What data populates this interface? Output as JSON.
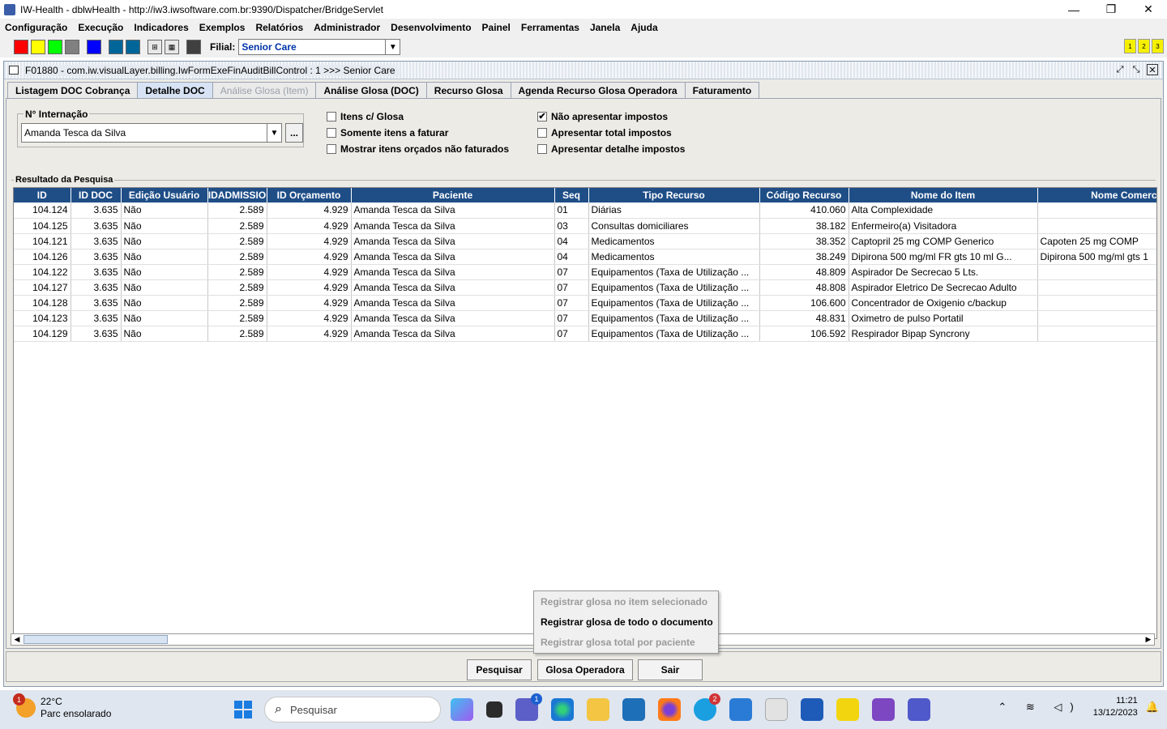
{
  "window": {
    "title": "IW-Health - dblwHealth - http://iw3.iwsoftware.com.br:9390/Dispatcher/BridgeServlet",
    "minimize": "—",
    "maximize": "❐",
    "close": "✕"
  },
  "menu": [
    "Configuração",
    "Execução",
    "Indicadores",
    "Exemplos",
    "Relatórios",
    "Administrador",
    "Desenvolvimento",
    "Painel",
    "Ferramentas",
    "Janela",
    "Ajuda"
  ],
  "toolbar": {
    "swatches": [
      "#ff0000",
      "#ffff00",
      "#00ff00",
      "#808080",
      "#0000ff",
      "#006699",
      "#006699"
    ],
    "filial_label": "Filial:",
    "filial_value": "Senior Care",
    "page_buttons": [
      "1",
      "2",
      "3"
    ]
  },
  "frame": {
    "title": "F01880 - com.iw.visualLayer.billing.IwFormExeFinAuditBillControl : 1 >>> Senior Care",
    "tabs": [
      {
        "label": "Listagem DOC Cobrança",
        "state": "normal"
      },
      {
        "label": "Detalhe DOC",
        "state": "active"
      },
      {
        "label": "Análise Glosa (Item)",
        "state": "disabled"
      },
      {
        "label": "Análise Glosa (DOC)",
        "state": "normal"
      },
      {
        "label": "Recurso Glosa",
        "state": "normal"
      },
      {
        "label": "Agenda Recurso Glosa Operadora",
        "state": "normal"
      },
      {
        "label": "Faturamento",
        "state": "normal"
      }
    ]
  },
  "filters": {
    "internacao_label": "N° Internação",
    "internacao_value": "Amanda Tesca da Silva",
    "lookup_button": "...",
    "checkboxes": [
      {
        "label": "Itens c/ Glosa",
        "checked": false
      },
      {
        "label": "Somente itens a faturar",
        "checked": false
      },
      {
        "label": "Mostrar itens orçados não faturados",
        "checked": false
      },
      {
        "label": "Não apresentar impostos",
        "checked": true
      },
      {
        "label": "Apresentar total impostos",
        "checked": false
      },
      {
        "label": "Apresentar detalhe impostos",
        "checked": false
      }
    ]
  },
  "results": {
    "label": "Resultado da Pesquisa",
    "columns": [
      "ID",
      "ID DOC",
      "Edição Usuário",
      "IDADMISSIO",
      "ID Orçamento",
      "Paciente",
      "Seq",
      "Tipo Recurso",
      "Código Recurso",
      "Nome do Item",
      "Nome Comerci"
    ],
    "rows": [
      [
        "104.124",
        "3.635",
        "Não",
        "2.589",
        "4.929",
        "Amanda Tesca da Silva",
        "01",
        "Diárias",
        "410.060",
        "Alta Complexidade",
        ""
      ],
      [
        "104.125",
        "3.635",
        "Não",
        "2.589",
        "4.929",
        "Amanda Tesca da Silva",
        "03",
        "Consultas domiciliares",
        "38.182",
        "Enfermeiro(a) Visitadora",
        ""
      ],
      [
        "104.121",
        "3.635",
        "Não",
        "2.589",
        "4.929",
        "Amanda Tesca da Silva",
        "04",
        "Medicamentos",
        "38.352",
        "Captopril    25 mg  COMP     Generico",
        "Capoten     25 mg  COMP"
      ],
      [
        "104.126",
        "3.635",
        "Não",
        "2.589",
        "4.929",
        "Amanda Tesca da Silva",
        "04",
        "Medicamentos",
        "38.249",
        "Dipirona    500 mg/ml  FR  gts 10 ml   G...",
        "Dipirona 500 mg/ml   gts 1"
      ],
      [
        "104.122",
        "3.635",
        "Não",
        "2.589",
        "4.929",
        "Amanda Tesca da Silva",
        "07",
        "Equipamentos (Taxa de Utilização ...",
        "48.809",
        "Aspirador De Secrecao 5 Lts.",
        ""
      ],
      [
        "104.127",
        "3.635",
        "Não",
        "2.589",
        "4.929",
        "Amanda Tesca da Silva",
        "07",
        "Equipamentos (Taxa de Utilização ...",
        "48.808",
        "Aspirador Eletrico De Secrecao Adulto",
        ""
      ],
      [
        "104.128",
        "3.635",
        "Não",
        "2.589",
        "4.929",
        "Amanda Tesca da Silva",
        "07",
        "Equipamentos (Taxa de Utilização ...",
        "106.600",
        "Concentrador de Oxigenio c/backup",
        ""
      ],
      [
        "104.123",
        "3.635",
        "Não",
        "2.589",
        "4.929",
        "Amanda Tesca da Silva",
        "07",
        "Equipamentos (Taxa de Utilização ...",
        "48.831",
        "Oximetro de pulso Portatil",
        ""
      ],
      [
        "104.129",
        "3.635",
        "Não",
        "2.589",
        "4.929",
        "Amanda Tesca da Silva",
        "07",
        "Equipamentos (Taxa de Utilização ...",
        "106.592",
        "Respirador Bipap Syncrony",
        ""
      ]
    ]
  },
  "context_menu": [
    {
      "label": "Registrar glosa no item selecionado",
      "enabled": false
    },
    {
      "label": "Registrar glosa de todo o documento",
      "enabled": true
    },
    {
      "label": "Registrar glosa total por paciente",
      "enabled": false
    }
  ],
  "buttons": {
    "pesquisar": "Pesquisar",
    "glosa_operadora": "Glosa Operadora",
    "sair": "Sair"
  },
  "taskbar": {
    "weather_temp": "22°C",
    "weather_desc": "Parc ensolarado",
    "weather_badge": "1",
    "search_placeholder": "Pesquisar",
    "time": "11:21",
    "date": "13/12/2023",
    "app_badges": {
      "teams_chat": "1",
      "skype": "2"
    }
  }
}
